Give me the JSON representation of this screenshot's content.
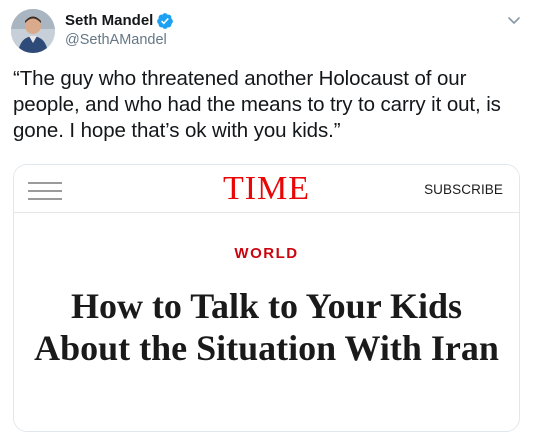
{
  "tweet": {
    "display_name": "Seth Mandel",
    "handle": "@SethAMandel",
    "verified": true,
    "text": "“The guy who threatened another Holocaust of our people, and who had the means to try to carry it out, is gone. I hope that’s ok with you kids.”",
    "avatar_icon": "user-avatar",
    "menu_icon": "chevron-down-icon"
  },
  "card": {
    "site_logo": "TIME",
    "subscribe_label": "SUBSCRIBE",
    "section_label": "WORLD",
    "headline": "How to Talk to Your Kids About the Situation With Iran",
    "menu_icon": "hamburger-menu-icon"
  },
  "colors": {
    "verified_blue": "#1da1f2",
    "time_red": "#e90606",
    "section_red": "#c9060f",
    "handle_gray": "#657786"
  }
}
